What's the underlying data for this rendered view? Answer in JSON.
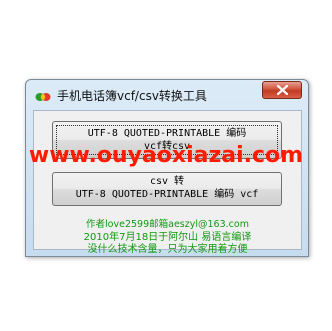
{
  "window": {
    "title": "手机电话簿vcf/csv转换工具"
  },
  "buttons": {
    "utf8_to_csv": {
      "line1": "UTF-8 QUOTED-PRINTABLE 编码",
      "line2": "vcf转csv"
    },
    "csv_to_utf8": {
      "line1": "csv 转",
      "line2": "UTF-8 QUOTED-PRINTABLE 编码 vcf"
    }
  },
  "info": {
    "line1": "作者love2599邮箱aeszyl@163.com",
    "line2": "2010年7月18日于阿尔山 易语言编译",
    "line3": "没什么技术含量，只为大家用着方便"
  },
  "watermark": "www.ouyaoxiazai.com",
  "icons": {
    "app": "app-icon",
    "close": "close-icon"
  },
  "colors": {
    "info_text": "#119911",
    "watermark": "#ff1a00",
    "close_button": "#c13a22"
  }
}
